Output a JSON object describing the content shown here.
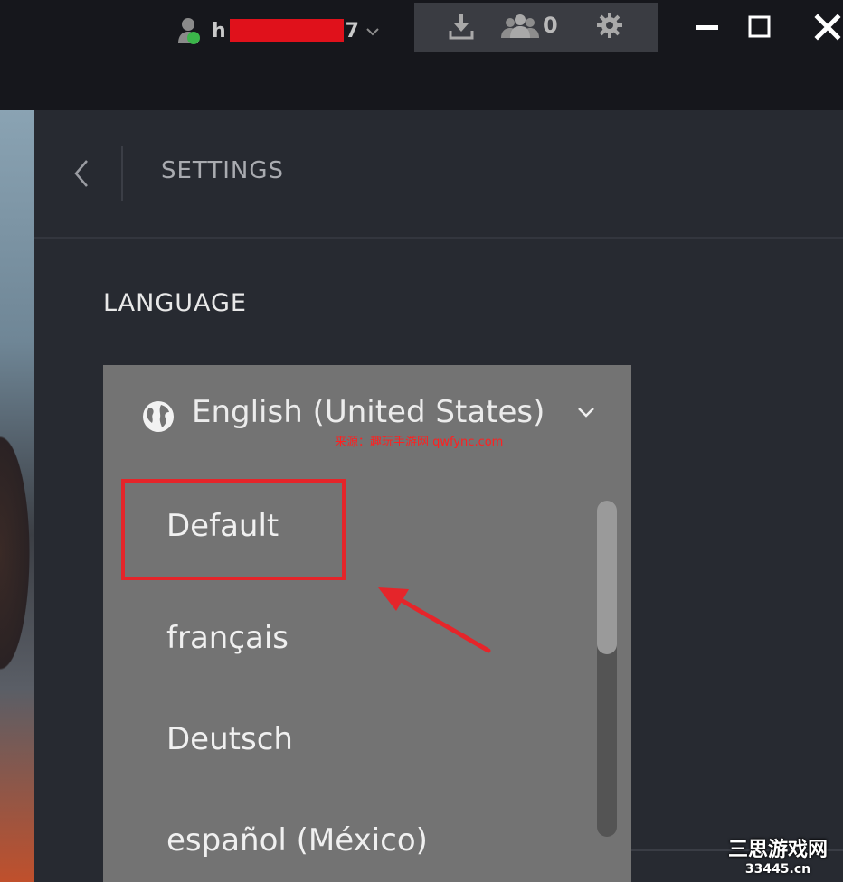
{
  "titlebar": {
    "username_start": "h",
    "username_end": "7",
    "friends_count": "0"
  },
  "settings": {
    "title": "SETTINGS",
    "section": "LANGUAGE"
  },
  "language_dropdown": {
    "selected": "English (United States)",
    "options": [
      "Default",
      "français",
      "Deutsch",
      "español (México)"
    ]
  },
  "watermarks": {
    "source": "来源：趣玩手游网 qwfync.com",
    "site_name": "三思游戏网",
    "site_url": "33445.cn"
  },
  "colors": {
    "highlight": "#e5252a",
    "online": "#3bb54a",
    "dropdown_bg": "#737373"
  },
  "icons": {
    "download": "download-icon",
    "friends": "friends-icon",
    "settings": "gear-icon",
    "minimize": "minimize-icon",
    "maximize": "maximize-icon",
    "close": "close-icon",
    "back": "chevron-left-icon",
    "globe": "globe-icon",
    "caret": "chevron-down-icon"
  }
}
